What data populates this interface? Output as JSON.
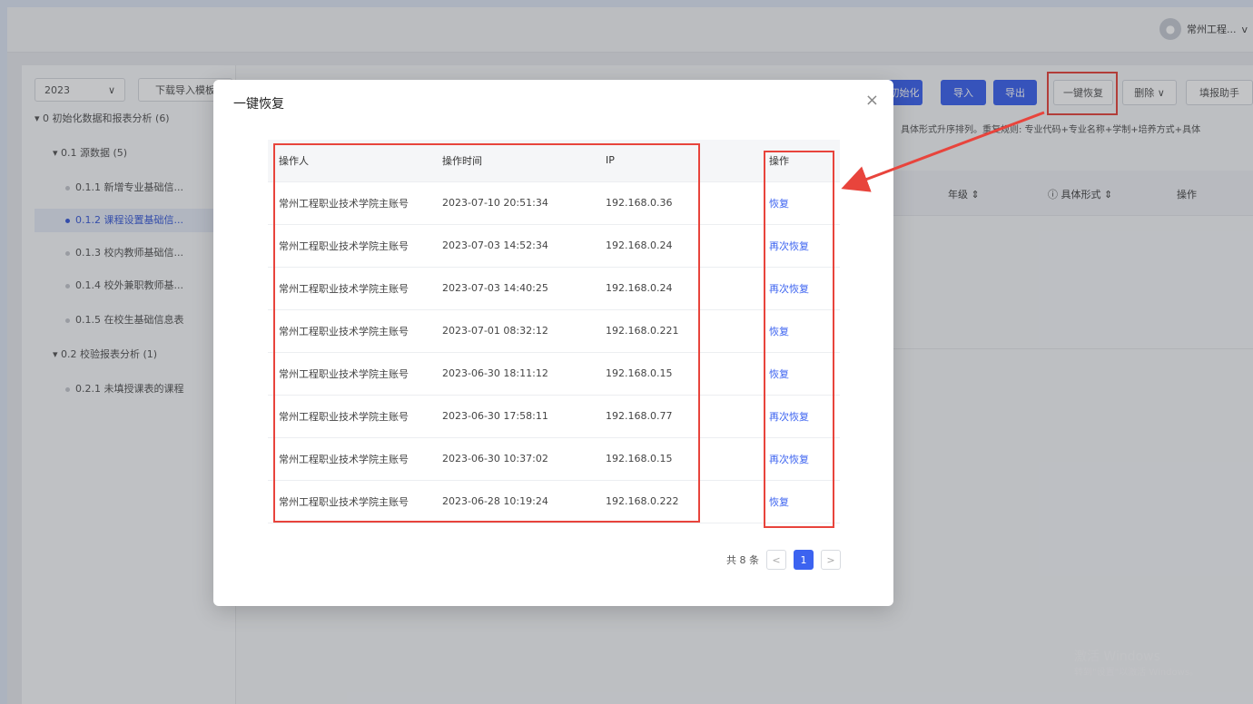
{
  "header": {
    "username": "常州工程...",
    "chevron": "v"
  },
  "sidebar": {
    "year": "2023",
    "download_label": "下载导入模板",
    "items": [
      {
        "label": "0 初始化数据和报表分析 (6)"
      },
      {
        "label": "0.1 源数据 (5)"
      },
      {
        "label": "0.1.1 新增专业基础信..."
      },
      {
        "label": "0.1.2 课程设置基础信..."
      },
      {
        "label": "0.1.3 校内教师基础信..."
      },
      {
        "label": "0.1.4 校外兼职教师基..."
      },
      {
        "label": "0.1.5 在校生基础信息表"
      },
      {
        "label": "0.2 校验报表分析 (1)"
      },
      {
        "label": "0.2.1 未填授课表的课程"
      }
    ]
  },
  "toolbar": {
    "init_label": "初始化",
    "import_label": "导入",
    "export_label": "导出",
    "restore_label": "一键恢复",
    "delete_label": "删除 ∨",
    "helper_label": "填报助手"
  },
  "rule_text": "具体形式升序排列。重复规则: 专业代码+专业名称+学制+培养方式+具体",
  "bg_table": {
    "col_grade": "年级 ⇕",
    "col_form": "ⓘ 具体形式 ⇕",
    "col_op": "操作"
  },
  "modal": {
    "title": "一键恢复",
    "close": "×",
    "columns": [
      "操作人",
      "操作时间",
      "IP",
      "",
      "操作"
    ],
    "rows": [
      {
        "operator": "常州工程职业技术学院主账号",
        "time": "2023-07-10 20:51:34",
        "ip": "192.168.0.36",
        "action": "恢复"
      },
      {
        "operator": "常州工程职业技术学院主账号",
        "time": "2023-07-03 14:52:34",
        "ip": "192.168.0.24",
        "action": "再次恢复"
      },
      {
        "operator": "常州工程职业技术学院主账号",
        "time": "2023-07-03 14:40:25",
        "ip": "192.168.0.24",
        "action": "再次恢复"
      },
      {
        "operator": "常州工程职业技术学院主账号",
        "time": "2023-07-01 08:32:12",
        "ip": "192.168.0.221",
        "action": "恢复"
      },
      {
        "operator": "常州工程职业技术学院主账号",
        "time": "2023-06-30 18:11:12",
        "ip": "192.168.0.15",
        "action": "恢复"
      },
      {
        "operator": "常州工程职业技术学院主账号",
        "time": "2023-06-30 17:58:11",
        "ip": "192.168.0.77",
        "action": "再次恢复"
      },
      {
        "operator": "常州工程职业技术学院主账号",
        "time": "2023-06-30 10:37:02",
        "ip": "192.168.0.15",
        "action": "再次恢复"
      },
      {
        "operator": "常州工程职业技术学院主账号",
        "time": "2023-06-28 10:19:24",
        "ip": "192.168.0.222",
        "action": "恢复"
      }
    ],
    "pager": {
      "total": "共 8 条",
      "prev": "<",
      "current": "1",
      "next": ">"
    }
  },
  "windows_watermark": {
    "line1": "激活 Windows",
    "line2": "转到\"设置\"以激活 Windows。"
  },
  "colors": {
    "primary": "#3c63f0",
    "highlight": "#e8443c"
  }
}
